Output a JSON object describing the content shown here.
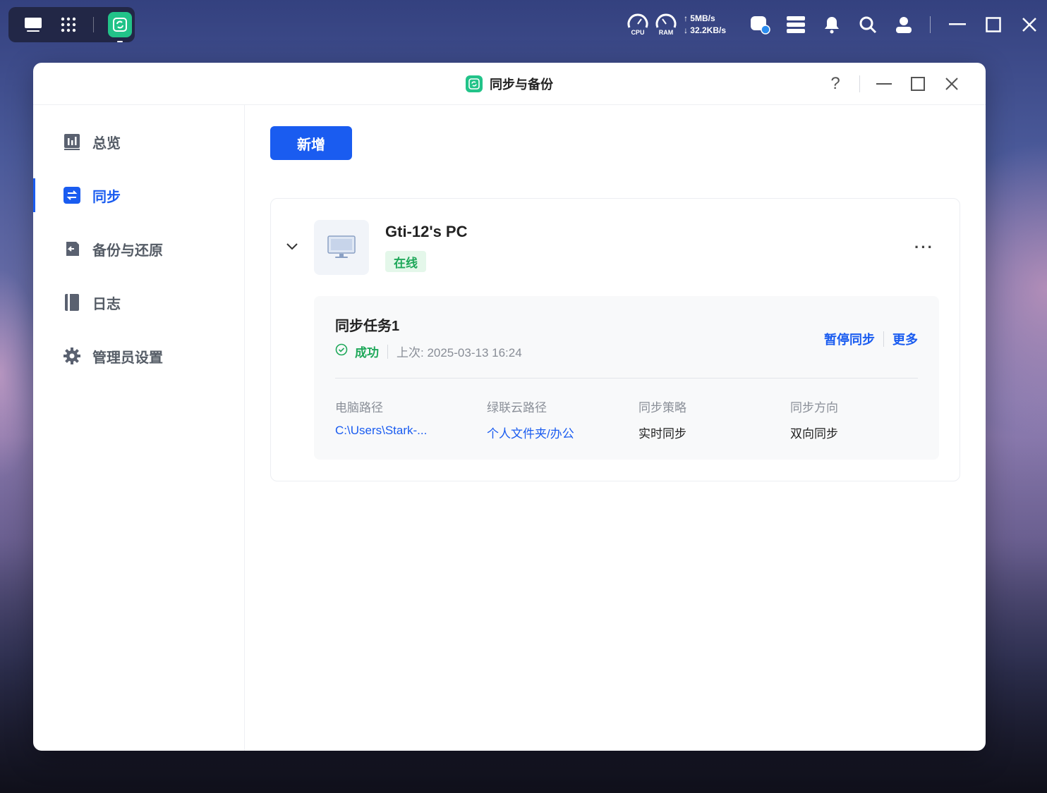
{
  "taskbar": {
    "cpu_label": "CPU",
    "ram_label": "RAM",
    "upload": "5MB/s",
    "download": "32.2KB/s"
  },
  "window": {
    "title": "同步与备份",
    "help": "?"
  },
  "sidebar": {
    "items": [
      {
        "label": "总览",
        "icon": "chart-icon"
      },
      {
        "label": "同步",
        "icon": "sync-icon",
        "active": true
      },
      {
        "label": "备份与还原",
        "icon": "backup-icon"
      },
      {
        "label": "日志",
        "icon": "log-icon"
      },
      {
        "label": "管理员设置",
        "icon": "gear-icon"
      }
    ]
  },
  "main": {
    "new_button": "新增",
    "device": {
      "name": "Gti-12's PC",
      "status": "在线",
      "more": "···",
      "task": {
        "name": "同步任务1",
        "result": "成功",
        "last_run": "上次: 2025-03-13 16:24",
        "pause_action": "暂停同步",
        "more_action": "更多",
        "columns": [
          {
            "label": "电脑路径",
            "value": "C:\\Users\\Stark-..."
          },
          {
            "label": "绿联云路径",
            "value": "个人文件夹/办公"
          },
          {
            "label": "同步策略",
            "value": "实时同步"
          },
          {
            "label": "同步方向",
            "value": "双向同步"
          }
        ]
      }
    }
  },
  "colors": {
    "accent": "#1a5cf0",
    "success": "#1fa85a",
    "app_green": "#22c389"
  }
}
